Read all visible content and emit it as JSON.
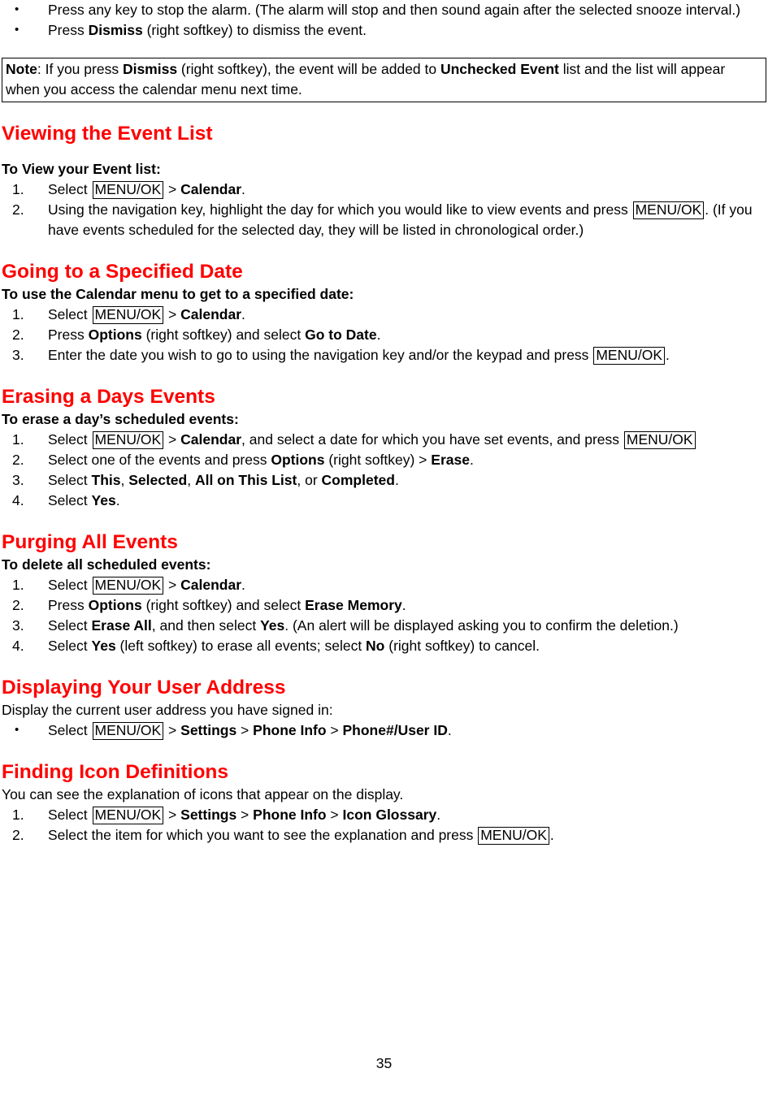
{
  "page": {
    "number": "35"
  },
  "intro_bullets": [
    {
      "prefix": "Press any key to stop the alarm. (The alarm will stop and then sound again after the selected snooze interval.)"
    },
    {
      "pre": "Press ",
      "bold": "Dismiss",
      "post": " (right softkey) to dismiss the event."
    }
  ],
  "note": {
    "label": "Note",
    "t1": ": If you press ",
    "b1": "Dismiss",
    "t2": " (right softkey), the event will be added to ",
    "b2": "Unchecked Event",
    "t3": " list and the list will appear when you access the calendar menu next time."
  },
  "sections": [
    {
      "id": "viewing-the-event-list",
      "heading": "Viewing the Event List",
      "subhead": "To View your Event list:",
      "steps": [
        {
          "t1": "Select ",
          "key": "MENU/OK",
          "t2": " > ",
          "b1": "Calendar",
          "t3": "."
        },
        {
          "t1": "Using the navigation key, highlight the day for which you would like to view events and press ",
          "key": "MENU/OK",
          "t2": ". (If you have events scheduled for the selected day, they will be listed in chronological order.)"
        }
      ]
    },
    {
      "id": "going-to-a-specified-date",
      "heading": "Going to a Specified Date",
      "subhead": "To use the Calendar menu to get to a specified date:",
      "steps": [
        {
          "t1": "Select ",
          "key": "MENU/OK",
          "t2": " > ",
          "b1": "Calendar",
          "t3": "."
        },
        {
          "t1": "Press ",
          "b1": "Options",
          "t2": " (right softkey) and select ",
          "b2": "Go to Date",
          "t3": "."
        },
        {
          "t1": "Enter the date you wish to go to using the navigation key and/or the keypad and press ",
          "key": "MENU/OK",
          "t2": "."
        }
      ]
    },
    {
      "id": "erasing-a-days-events",
      "heading": "Erasing a Days Events",
      "subhead": "To erase a day’s scheduled events:",
      "steps": [
        {
          "t1": "Select ",
          "key": "MENU/OK",
          "t2": " > ",
          "b1": "Calendar",
          "t3": ", and select a date for which you have set events, and press ",
          "key2": "MENU/OK"
        },
        {
          "t1": "Select one of the events and press ",
          "b1": "Options",
          "t2": " (right softkey) > ",
          "b2": "Erase",
          "t3": "."
        },
        {
          "t1": "Select ",
          "b1": "This",
          "t2": ", ",
          "b2": "Selected",
          "t3": ", ",
          "b3": "All on This List",
          "t4": ", or ",
          "b4": "Completed",
          "t5": "."
        },
        {
          "t1": "Select ",
          "b1": "Yes",
          "t2": "."
        }
      ]
    },
    {
      "id": "purging-all-events",
      "heading": "Purging All Events",
      "subhead": "To delete all scheduled events:",
      "steps": [
        {
          "t1": "Select ",
          "key": "MENU/OK",
          "t2": " > ",
          "b1": "Calendar",
          "t3": "."
        },
        {
          "t1": "Press ",
          "b1": "Options",
          "t2": " (right softkey) and select ",
          "b2": "Erase Memory",
          "t3": "."
        },
        {
          "t1": "Select ",
          "b1": "Erase All",
          "t2": ", and then select ",
          "b2": "Yes",
          "t3": ". (An alert will be displayed asking you to confirm the deletion.)"
        },
        {
          "t1": "Select ",
          "b1": "Yes",
          "t2": " (left softkey) to erase all events; select ",
          "b2": "No",
          "t3": " (right softkey) to cancel."
        }
      ]
    },
    {
      "id": "displaying-your-user-address",
      "heading": "Displaying Your User Address",
      "intro": "Display the current user address you have signed in:",
      "bullet": {
        "t1": "Select ",
        "key": "MENU/OK",
        "t2": " > ",
        "b1": "Settings",
        "t3": " > ",
        "b2": "Phone Info",
        "t4": " > ",
        "b3": "Phone#/User ID",
        "t5": "."
      }
    },
    {
      "id": "finding-icon-definitions",
      "heading": "Finding Icon Definitions",
      "intro": "You can see the explanation of icons that appear on the display.",
      "steps": [
        {
          "t1": "Select ",
          "key": "MENU/OK",
          "t2": " > ",
          "b1": "Settings",
          "t3": " > ",
          "b2": "Phone Info",
          "t4": " > ",
          "b3": "Icon Glossary",
          "t5": "."
        },
        {
          "t1": "Select the item for which you want to see the explanation and press ",
          "key": "MENU/OK",
          "t2": "."
        }
      ]
    }
  ]
}
